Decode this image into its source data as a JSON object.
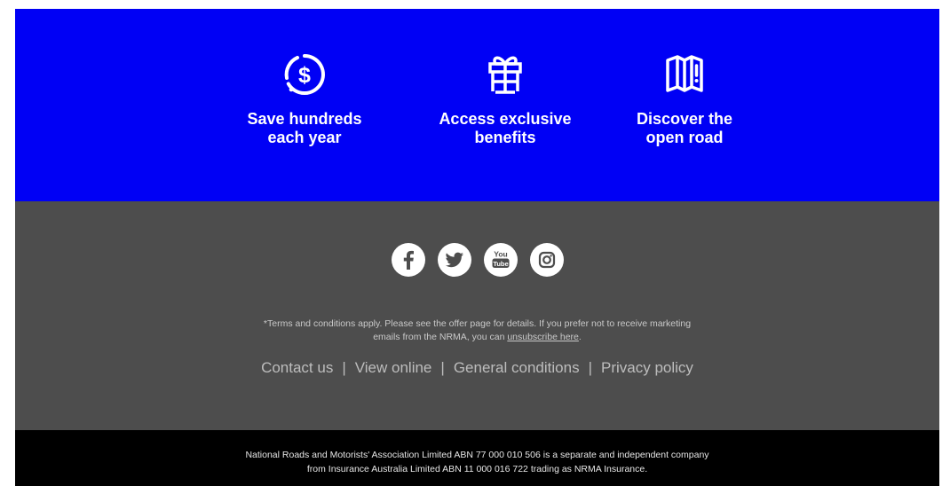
{
  "benefits": {
    "items": [
      {
        "icon": "dollar-circle-icon",
        "label": "Save hundreds\neach year"
      },
      {
        "icon": "gift-icon",
        "label": "Access exclusive\nbenefits"
      },
      {
        "icon": "map-icon",
        "label": "Discover the\nopen road"
      }
    ]
  },
  "social": {
    "items": [
      {
        "icon": "facebook-icon",
        "name": "Facebook"
      },
      {
        "icon": "twitter-icon",
        "name": "Twitter"
      },
      {
        "icon": "youtube-icon",
        "name": "YouTube",
        "glyph_top": "You",
        "glyph_bottom": "Tube"
      },
      {
        "icon": "instagram-icon",
        "name": "Instagram"
      }
    ]
  },
  "disclaimer": {
    "line1": "*Terms and conditions apply. Please see the offer page for details. If you prefer not to receive marketing",
    "line2_prefix": "emails from the NRMA, you can ",
    "unsubscribe_label": "unsubscribe here",
    "line2_suffix": "."
  },
  "footer_links": {
    "contact": "Contact us",
    "view_online": "View online",
    "general_conditions": "General conditions",
    "privacy": "Privacy policy",
    "separator": "|"
  },
  "legal": {
    "line1": "National Roads and Motorists' Association Limited ABN 77 000 010 506 is a separate and independent company",
    "line2": "from Insurance Australia Limited ABN 11 000 016 722 trading as NRMA Insurance."
  },
  "colors": {
    "benefits_bg": "#0000f5",
    "footer_bg": "#4d4d4d",
    "legal_bg": "#000000"
  }
}
